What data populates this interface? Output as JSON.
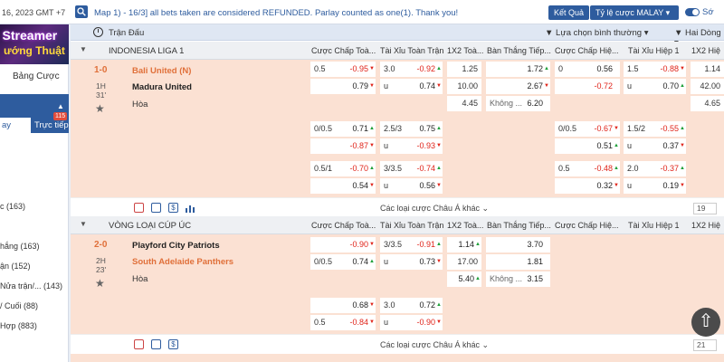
{
  "topbar": {
    "date": "16, 2023 GMT +7",
    "message": "Map 1) - 16/3] all bets taken are considered REFUNDED. Parlay counted as one(1). Thank you!",
    "results_btn": "Kết Quả",
    "odds_btn": "Tỷ lệ cược MALAY",
    "toggle_label": "Sớ"
  },
  "left": {
    "banner_line1": "t Streamer",
    "banner_line2": "ướng Thuật",
    "bet_slip": "Bảng Cược",
    "tab1": "ay",
    "tab2": "Trực tiếp",
    "badge": "115",
    "items": [
      "c (163)",
      "hắng (163)",
      "ận (152)",
      "Nửa trận/... (143)",
      "/ Cuối (88)",
      "Hợp (883)"
    ]
  },
  "grid": {
    "match_col": "Trận Đấu",
    "select1": "Lựa chọn bình thường",
    "select2": "Hai Dòng",
    "columns": [
      "Cược Chấp Toà...",
      "Tài Xỉu Toàn Trận",
      "1X2 Toà...",
      "Bàn Thắng Tiếp...",
      "Cược Chấp Hiệ...",
      "Tài Xỉu Hiệp 1",
      "1X2 Hiệ"
    ],
    "more_label": "Các loại cược Châu Á khác",
    "sections": [
      {
        "league": "INDONESIA LIGA 1",
        "score": "1-0",
        "time1": "1H",
        "time2": "31'",
        "home": "Bali United (N)",
        "away": "Madura United",
        "draw": "Hòa",
        "page": "19",
        "r1": {
          "ah_h": "0.5",
          "ah_o": "-0.95",
          "ou_h": "3.0",
          "ou_o": "-0.92",
          "x": "1.25",
          "nx": "1.72",
          "hah_h": "0",
          "hah_o": "0.56",
          "hou_h": "1.5",
          "hou_o": "-0.88",
          "hx": "1.14"
        },
        "r2": {
          "ah_o": "0.79",
          "ou_h": "u",
          "ou_o": "0.74",
          "x": "10.00",
          "nx": "2.67",
          "hah_o": "-0.72",
          "hou_h": "u",
          "hou_o": "0.70",
          "hx": "42.00"
        },
        "r3": {
          "x": "4.45",
          "nx_h": "Không ...",
          "nx": "6.20",
          "hx": "4.65"
        },
        "r4": {
          "ah_h": "0/0.5",
          "ah_o": "0.71",
          "ou_h": "2.5/3",
          "ou_o": "0.75",
          "hah_h": "0/0.5",
          "hah_o": "-0.67",
          "hou_h": "1.5/2",
          "hou_o": "-0.55"
        },
        "r5": {
          "ah_o": "-0.87",
          "ou_h": "u",
          "ou_o": "-0.93",
          "hah_o": "0.51",
          "hou_h": "u",
          "hou_o": "0.37"
        },
        "r6": {
          "ah_h": "0.5/1",
          "ah_o": "-0.70",
          "ou_h": "3/3.5",
          "ou_o": "-0.74",
          "hah_h": "0.5",
          "hah_o": "-0.48",
          "hou_h": "2.0",
          "hou_o": "-0.37"
        },
        "r7": {
          "ah_o": "0.54",
          "ou_h": "u",
          "ou_o": "0.56",
          "hah_o": "0.32",
          "hou_h": "u",
          "hou_o": "0.19"
        }
      },
      {
        "league": "VÒNG LOẠI CÚP ÚC",
        "score": "2-0",
        "time1": "2H",
        "time2": "23'",
        "home": "Playford City Patriots",
        "away": "South Adelaide Panthers",
        "draw": "Hòa",
        "page": "21",
        "r1": {
          "ah_o": "-0.90",
          "ou_h": "3/3.5",
          "ou_o": "-0.91",
          "x": "1.14",
          "nx": "3.70"
        },
        "r2": {
          "ah_h": "0/0.5",
          "ah_o": "0.74",
          "ou_h": "u",
          "ou_o": "0.73",
          "x": "17.00",
          "nx": "1.81"
        },
        "r3": {
          "x": "5.40",
          "nx_h": "Không ...",
          "nx": "3.15"
        },
        "r4": {
          "ah_o": "0.68",
          "ou_h": "3.0",
          "ou_o": "0.72"
        },
        "r5": {
          "ah_h": "0.5",
          "ah_o": "-0.84",
          "ou_h": "u",
          "ou_o": "-0.90"
        }
      }
    ]
  }
}
